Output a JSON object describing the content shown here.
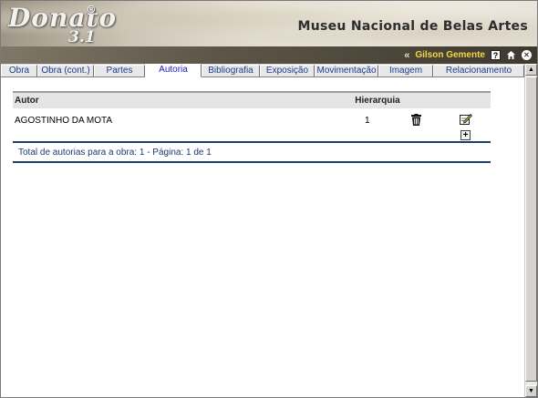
{
  "header": {
    "logo": "Donato",
    "logo_version": "3.1",
    "logo_mark": "®",
    "museum": "Museu Nacional de Belas Artes"
  },
  "userbar": {
    "back": "«",
    "user": "Gilson Gemente",
    "icons": [
      "help-icon",
      "home-icon",
      "close-icon"
    ]
  },
  "tabs": [
    {
      "label": "Obra"
    },
    {
      "label": "Obra (cont.)"
    },
    {
      "label": "Partes"
    },
    {
      "label": "Autoria"
    },
    {
      "label": "Bibliografia"
    },
    {
      "label": "Exposição"
    },
    {
      "label": "Movimentação"
    },
    {
      "label": "Imagem"
    },
    {
      "label": "Relacionamento"
    }
  ],
  "active_tab": "Autoria",
  "table": {
    "headers": {
      "autor": "Autor",
      "hierarquia": "Hierarquia"
    },
    "rows": [
      {
        "autor": "AGOSTINHO DA MOTA",
        "hierarquia": "1"
      }
    ],
    "footer": "Total de autorias para a obra: 1 - Página: 1 de 1"
  },
  "colors": {
    "tab_text": "#1e3c8c",
    "active_tab_text": "#1a1acc",
    "divider": "#1c3e6b",
    "user_name": "#f5d742"
  }
}
